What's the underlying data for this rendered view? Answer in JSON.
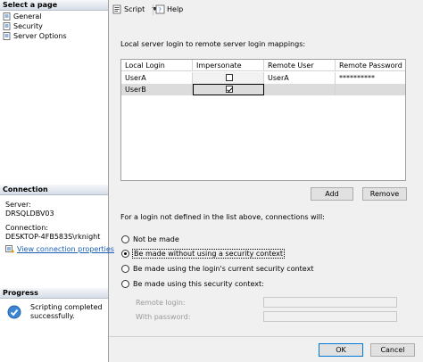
{
  "left_pane": {
    "select_page_header": "Select a page",
    "pages": [
      {
        "label": "General",
        "icon": "page-icon"
      },
      {
        "label": "Security",
        "icon": "page-icon"
      },
      {
        "label": "Server Options",
        "icon": "page-icon"
      }
    ],
    "connection_header": "Connection",
    "server_label": "Server:",
    "server_value": "DRSQLDBV03",
    "connection_label": "Connection:",
    "connection_value": "DESKTOP-4FB583S\\rknight",
    "view_connection_properties": "View connection properties",
    "progress_header": "Progress",
    "progress_status": "Scripting completed successfully.",
    "progress_status_line1": "Scripting completed",
    "progress_status_line2": "successfully."
  },
  "toolbar": {
    "script_label": "Script",
    "help_label": "Help"
  },
  "main": {
    "mappings_label": "Local server login to remote server login mappings:",
    "grid": {
      "columns": [
        "Local Login",
        "Impersonate",
        "Remote User",
        "Remote Password"
      ],
      "rows": [
        {
          "local_login": "UserA",
          "impersonate": false,
          "remote_user": "UserA",
          "remote_password": "**********"
        },
        {
          "local_login": "UserB",
          "impersonate": true,
          "remote_user": "",
          "remote_password": ""
        }
      ]
    },
    "add_button": "Add",
    "remove_button": "Remove",
    "not_defined_label": "For a login not defined in the list above, connections will:",
    "options": [
      {
        "label": "Not be made",
        "selected": false
      },
      {
        "label": "Be made without using a security context",
        "selected": true
      },
      {
        "label": "Be made using the login's current security context",
        "selected": false
      },
      {
        "label": "Be made using this security context:",
        "selected": false
      }
    ],
    "remote_login_label": "Remote login:",
    "with_password_label": "With password:",
    "remote_login_value": "",
    "with_password_value": ""
  },
  "footer": {
    "ok_button": "OK",
    "cancel_button": "Cancel"
  }
}
